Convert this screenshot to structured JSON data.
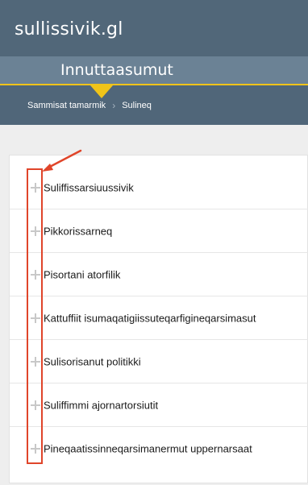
{
  "site": {
    "logo": "sullissivik.gl"
  },
  "section": {
    "title": "Innuttaasumut"
  },
  "breadcrumb": {
    "items": [
      "Sammisat tamarmik",
      "Sulineq"
    ],
    "separator": "›"
  },
  "list": {
    "items": [
      {
        "label": "Suliffissarsiuussivik",
        "icon": "plus-icon"
      },
      {
        "label": "Pikkorissarneq",
        "icon": "plus-icon"
      },
      {
        "label": "Pisortani atorfilik",
        "icon": "plus-icon"
      },
      {
        "label": "Kattuffiit isumaqatigiissuteqarfigineqarsimasut",
        "icon": "plus-icon"
      },
      {
        "label": "Sulisorisanut politikki",
        "icon": "plus-icon"
      },
      {
        "label": "Suliffimmi ajornartorsiutit",
        "icon": "plus-icon"
      },
      {
        "label": "Pineqaatissinneqarsimanermut uppernarsaat",
        "icon": "plus-icon"
      }
    ]
  },
  "colors": {
    "header": "#516779",
    "section_bar": "#6b8295",
    "accent": "#f0c419",
    "annotation": "#e0452a"
  }
}
